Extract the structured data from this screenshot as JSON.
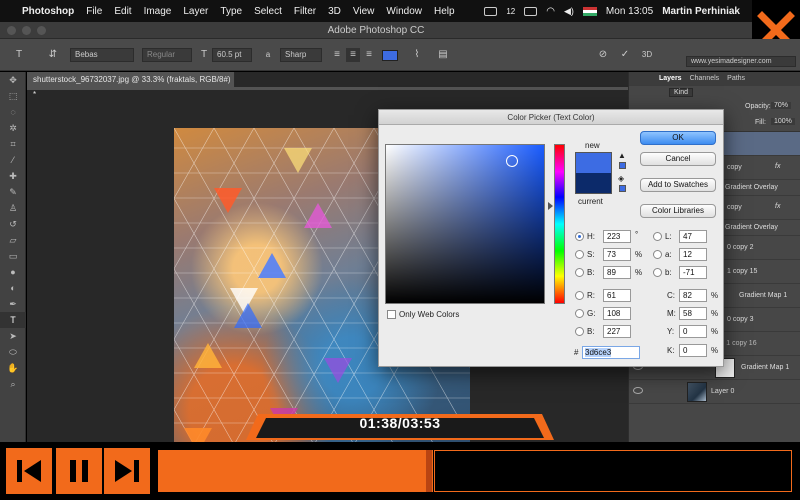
{
  "menubar": {
    "app": "Photoshop",
    "items": [
      "File",
      "Edit",
      "Image",
      "Layer",
      "Type",
      "Select",
      "Filter",
      "3D",
      "View",
      "Window",
      "Help"
    ],
    "badge": "12",
    "clock": "Mon 13:05",
    "user": "Martin Perhiniak"
  },
  "window": {
    "title": "Adobe Photoshop CC"
  },
  "options": {
    "font_family": "Bebas",
    "font_style": "Regular",
    "font_size": "60.5 pt",
    "antialias_label": "a",
    "antialias": "Sharp",
    "text_color": "#3d6ce3",
    "workspace": "www.yesimadesigner.com"
  },
  "document": {
    "tab": "shutterstock_96732037.jpg @ 33.3% (fraktals, RGB/8#) *"
  },
  "layers_panel": {
    "tabs": [
      "Layers",
      "Channels",
      "Paths"
    ],
    "kind": "Kind",
    "opacity_label": "Opacity:",
    "opacity": "70%",
    "fill_label": "Fill:",
    "fill": "100%",
    "rows": [
      {
        "name": "copy",
        "fx": "fx"
      },
      {
        "name": "Gradient Overlay"
      },
      {
        "name": "copy",
        "fx": "fx"
      },
      {
        "name": "Gradient Overlay"
      },
      {
        "name": "0 copy 2"
      },
      {
        "name": "1 copy 15"
      },
      {
        "name": "Gradient Map 1"
      },
      {
        "name": "0 copy 3"
      },
      {
        "name": "Polygon 1 copy 16"
      },
      {
        "name": "Gradient Map 1"
      },
      {
        "name": "Layer 0"
      }
    ]
  },
  "color_picker": {
    "title": "Color Picker (Text Color)",
    "new_label": "new",
    "current_label": "current",
    "new_color": "#3d6ce3",
    "current_color": "#0c2a6a",
    "ok": "OK",
    "cancel": "Cancel",
    "add_swatches": "Add to Swatches",
    "libraries": "Color Libraries",
    "only_web": "Only Web Colors",
    "hsb": {
      "h": "223",
      "s": "73",
      "b": "89",
      "h_unit": "°",
      "s_unit": "%",
      "b_unit": "%"
    },
    "rgb": {
      "r": "61",
      "g": "108",
      "b": "227"
    },
    "lab": {
      "l": "47",
      "a": "12",
      "b": "-71"
    },
    "cmyk": {
      "c": "82",
      "m": "58",
      "y": "0",
      "k": "0",
      "unit": "%"
    },
    "hex_label": "#",
    "hex": "3d6ce3",
    "labels": {
      "h": "H:",
      "s": "S:",
      "b": "B:",
      "r": "R:",
      "g": "G:",
      "bb": "B:",
      "l": "L:",
      "a": "a:",
      "lb": "b:",
      "c": "C:",
      "m": "M:",
      "y": "Y:",
      "k": "K:"
    }
  },
  "video": {
    "time": "01:38/03:53",
    "progress": 0.53,
    "accent": "#f26a1b"
  }
}
